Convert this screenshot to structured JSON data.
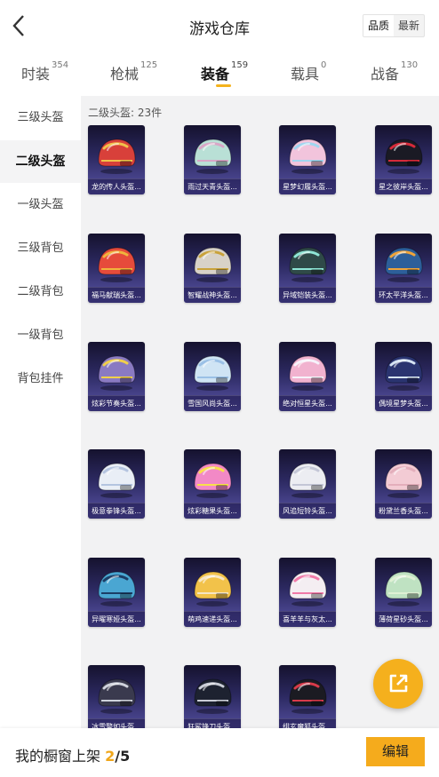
{
  "header": {
    "title": "游戏仓库",
    "sort_options": [
      "品质",
      "最新"
    ],
    "active_sort": "品质"
  },
  "tabs": [
    {
      "label": "时装",
      "count": "354"
    },
    {
      "label": "枪械",
      "count": "125"
    },
    {
      "label": "装备",
      "count": "159",
      "active": true
    },
    {
      "label": "载具",
      "count": "0"
    },
    {
      "label": "战备",
      "count": "130"
    }
  ],
  "sidebar": {
    "items": [
      "三级头盔",
      "二级头盔",
      "一级头盔",
      "三级背包",
      "二级背包",
      "一级背包",
      "背包挂件"
    ],
    "active": "二级头盔"
  },
  "section": {
    "title": "二级头盔: 23件"
  },
  "items": [
    {
      "name": "龙的传人头盔...",
      "color": "#d8403a",
      "accent": "#f1c24a"
    },
    {
      "name": "雨过天青头盔...",
      "color": "#b9e0d6",
      "accent": "#d9a6c6"
    },
    {
      "name": "星梦幻履头盔...",
      "color": "#f2c4dc",
      "accent": "#9fd6f0"
    },
    {
      "name": "星之彼岸头盔...",
      "color": "#1a1a24",
      "accent": "#d62a3a"
    },
    {
      "name": "福马献瑞头盔...",
      "color": "#e64b3b",
      "accent": "#f0b43c"
    },
    {
      "name": "智耀战神头盔...",
      "color": "#d8d2c8",
      "accent": "#c9a23a"
    },
    {
      "name": "异域铠装头盔...",
      "color": "#2f4a48",
      "accent": "#8fe6d6"
    },
    {
      "name": "环太平洋头盔...",
      "color": "#2d5f9a",
      "accent": "#f0a43a"
    },
    {
      "name": "炫彩节奏头盔...",
      "color": "#8a7ac2",
      "accent": "#f1d04a"
    },
    {
      "name": "雪国风尚头盔...",
      "color": "#cfe4f4",
      "accent": "#9ac0e6"
    },
    {
      "name": "绝对恒星头盔...",
      "color": "#f1b2cf",
      "accent": "#f6f2fa"
    },
    {
      "name": "偶境星梦头盔...",
      "color": "#2a3470",
      "accent": "#d6e4f4"
    },
    {
      "name": "极意拳锋头盔...",
      "color": "#e9eef6",
      "accent": "#b4c4e0"
    },
    {
      "name": "炫彩糖果头盔...",
      "color": "#f289c6",
      "accent": "#f8e04a"
    },
    {
      "name": "风追短铃头盔...",
      "color": "#ecedf2",
      "accent": "#c3c6d6"
    },
    {
      "name": "粉黛兰香头盔...",
      "color": "#f3cbd4",
      "accent": "#e3aebb"
    },
    {
      "name": "异曜寒娅头盔...",
      "color": "#4aa6d2",
      "accent": "#1b3e66"
    },
    {
      "name": "萌鸡速递头盔...",
      "color": "#f2c24a",
      "accent": "#f6e6c4"
    },
    {
      "name": "喜羊羊与灰太...",
      "color": "#f4eef2",
      "accent": "#f07aa8"
    },
    {
      "name": "薄荷星砂头盔...",
      "color": "#bfe2c2",
      "accent": "#dff0d4"
    },
    {
      "name": "冰雪警如头盔...",
      "color": "#3a3a4e",
      "accent": "#cfd2dc"
    },
    {
      "name": "狂鲨锋刀头盔...",
      "color": "#1d2230",
      "accent": "#c9ccd6"
    },
    {
      "name": "绯玄魔狐头盔...",
      "color": "#1b1b22",
      "accent": "#d83a4a"
    }
  ],
  "bottom": {
    "showcase_label": "我的橱窗上架",
    "showcase_current": "2",
    "showcase_total": "/5",
    "edit_label": "编辑"
  },
  "colors": {
    "accent": "#f5ab1c",
    "card_bg_top": "#15122e",
    "card_bg_bottom": "#5a55a8"
  }
}
